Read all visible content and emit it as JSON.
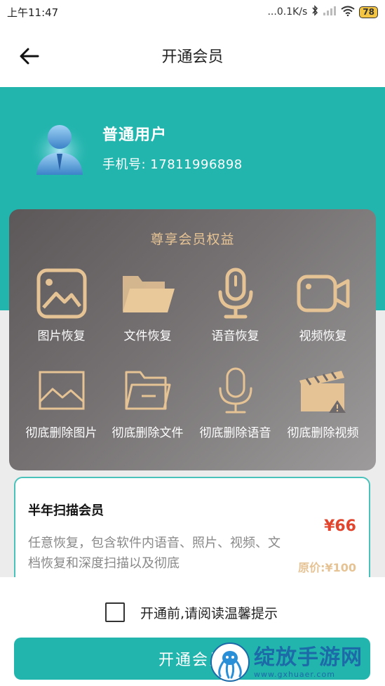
{
  "status_bar": {
    "time": "上午11:47",
    "network_speed": "...0.1K/s",
    "battery": "78"
  },
  "nav": {
    "title": "开通会员"
  },
  "user": {
    "name": "普通用户",
    "phone": "手机号:  17811996898"
  },
  "benefits": {
    "title": "尊享会员权益",
    "items": [
      {
        "label": "图片恢复",
        "icon": "image-icon"
      },
      {
        "label": "文件恢复",
        "icon": "folder-icon"
      },
      {
        "label": "语音恢复",
        "icon": "microphone-icon"
      },
      {
        "label": "视频恢复",
        "icon": "video-camera-icon"
      },
      {
        "label": "彻底删除图片",
        "icon": "image-outline-icon"
      },
      {
        "label": "彻底删除文件",
        "icon": "folder-outline-icon"
      },
      {
        "label": "彻底删除语音",
        "icon": "microphone-outline-icon"
      },
      {
        "label": "彻底删除视频",
        "icon": "clapperboard-icon"
      }
    ]
  },
  "plan": {
    "name": "半年扫描会员",
    "description": "任意恢复，包含软件内语音、照片、视频、文档恢复和深度扫描以及彻底",
    "price": "¥66",
    "original_price": "原价:¥100"
  },
  "agreement": {
    "text": "开通前,请阅读温馨提示"
  },
  "submit": {
    "label": "开通会员"
  },
  "watermark": {
    "text": "绽放手游网",
    "url": "www.gxhuaer.com"
  },
  "colors": {
    "accent": "#22b5ad",
    "gold": "#e6c394",
    "price": "#e2452e"
  }
}
